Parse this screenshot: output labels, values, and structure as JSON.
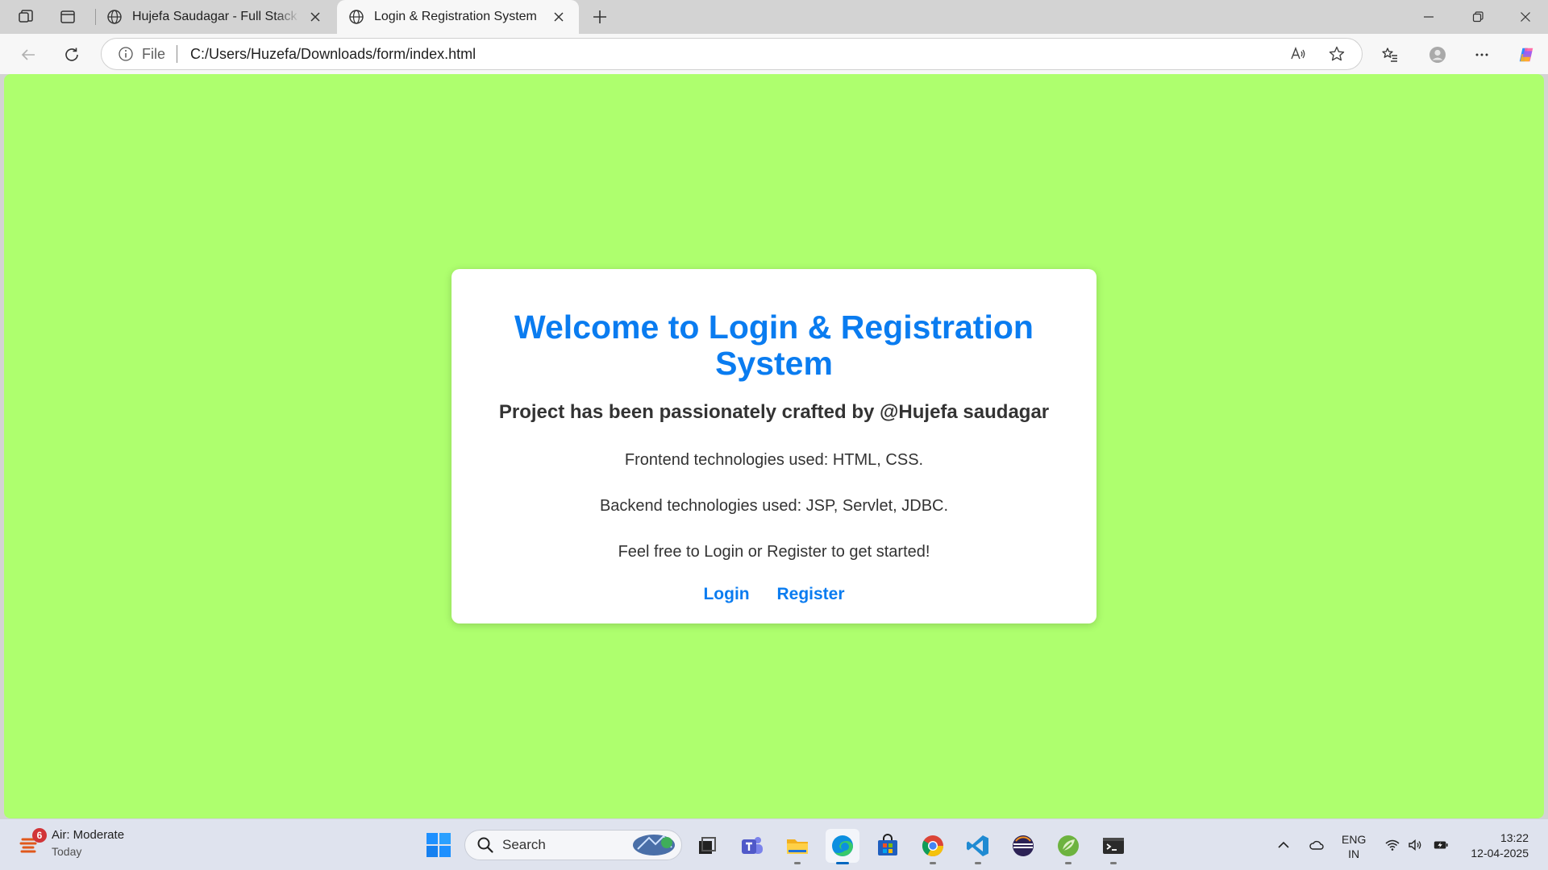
{
  "browser": {
    "tabs": [
      {
        "title": "Hujefa Saudagar - Full Stack Java",
        "active": false
      },
      {
        "title": "Login & Registration System",
        "active": true
      }
    ],
    "address": {
      "scheme_label": "File",
      "url": "C:/Users/Huzefa/Downloads/form/index.html"
    }
  },
  "page": {
    "background_color": "#aeff6e",
    "accent_color": "#0a7cf0",
    "title": "Welcome to Login & Registration System",
    "subtitle": "Project has been passionately crafted by @Hujefa saudagar",
    "paragraphs": [
      "Frontend technologies used: HTML, CSS.",
      "Backend technologies used: JSP, Servlet, JDBC.",
      "Feel free to Login or Register to get started!"
    ],
    "links": {
      "login": "Login",
      "register": "Register"
    }
  },
  "taskbar": {
    "weather": {
      "badge": "6",
      "condition": "Air: Moderate",
      "when": "Today"
    },
    "search_placeholder": "Search",
    "apps": [
      "task-view",
      "teams",
      "file-explorer",
      "edge",
      "store",
      "chrome",
      "vscode",
      "eclipse",
      "spring-tools",
      "terminal"
    ],
    "language": {
      "line1": "ENG",
      "line2": "IN"
    },
    "clock": {
      "time": "13:22",
      "date": "12-04-2025"
    }
  }
}
